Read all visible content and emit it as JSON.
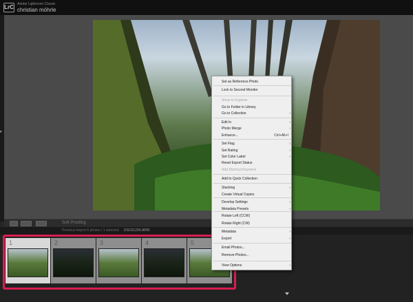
{
  "header": {
    "logo_text": "LrC",
    "app_name": "Adobe Lightroom Classic",
    "user_name": "christian möhrle"
  },
  "toolbar": {
    "soft_proofing": "Soft Proofing"
  },
  "filmstrip": {
    "header_text": "Previous Import  6 photos / 1 selected",
    "sort_label": "DSC01234.ARW",
    "cells": [
      {
        "number": "1",
        "selected": true,
        "tone": "mid"
      },
      {
        "number": "2",
        "selected": false,
        "tone": "dark"
      },
      {
        "number": "3",
        "selected": false,
        "tone": "mid"
      },
      {
        "number": "4",
        "selected": false,
        "tone": "dark"
      },
      {
        "number": "5",
        "selected": false,
        "tone": "mid"
      }
    ]
  },
  "context_menu": {
    "items": [
      {
        "label": "Set as Reference Photo",
        "disabled": false
      },
      {
        "label": "Lock to Second Monitor",
        "disabled": false
      },
      {
        "label": "Show in Explorer",
        "disabled": true
      },
      {
        "label": "Go to Folder in Library",
        "disabled": false
      },
      {
        "label": "Go to Collection",
        "disabled": false,
        "submenu": true
      },
      {
        "label": "Edit In",
        "disabled": false,
        "submenu": true
      },
      {
        "label": "Photo Merge",
        "disabled": false,
        "submenu": true
      },
      {
        "label": "Enhance...",
        "disabled": false,
        "shortcut": "Ctrl+Alt+I"
      },
      {
        "label": "Set Flag",
        "disabled": false,
        "submenu": true
      },
      {
        "label": "Set Rating",
        "disabled": false,
        "submenu": true
      },
      {
        "label": "Set Color Label",
        "disabled": false,
        "submenu": true
      },
      {
        "label": "Reset Export Status",
        "disabled": false
      },
      {
        "label": "Add Shortcut Keyword",
        "disabled": true
      },
      {
        "label": "Add to Quick Collection",
        "disabled": false
      },
      {
        "label": "Stacking",
        "disabled": false,
        "submenu": true
      },
      {
        "label": "Create Virtual Copies",
        "disabled": false
      },
      {
        "label": "Develop Settings",
        "disabled": false,
        "submenu": true
      },
      {
        "label": "Metadata Presets",
        "disabled": false,
        "submenu": true
      },
      {
        "label": "Rotate Left (CCW)",
        "disabled": false
      },
      {
        "label": "Rotate Right (CW)",
        "disabled": false
      },
      {
        "label": "Metadata",
        "disabled": false,
        "submenu": true
      },
      {
        "label": "Export",
        "disabled": false,
        "submenu": true
      },
      {
        "label": "Email Photos...",
        "disabled": false
      },
      {
        "label": "Remove Photos...",
        "disabled": false
      },
      {
        "label": "View Options",
        "disabled": false,
        "submenu": true
      }
    ],
    "arrow_glyph": "›"
  },
  "colors": {
    "selection_border": "#d91e4f",
    "menu_bg": "#efefef"
  }
}
